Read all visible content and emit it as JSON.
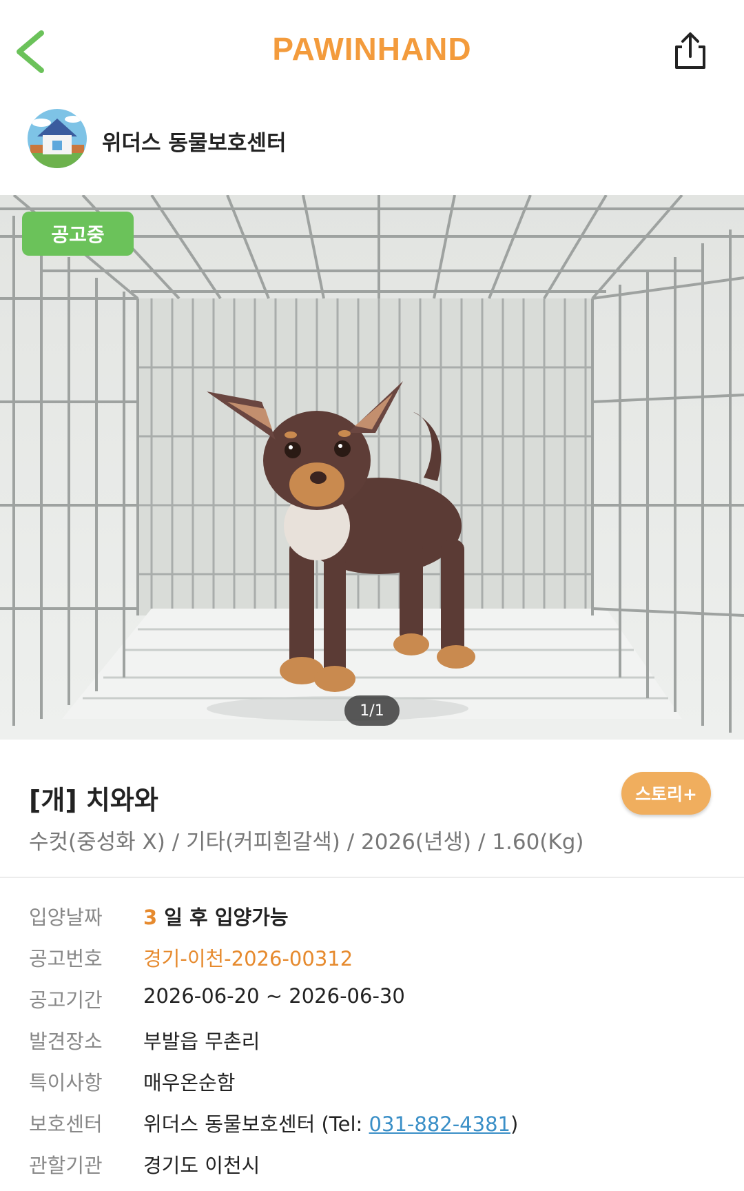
{
  "header": {
    "brand": "PAWINHAND"
  },
  "shelter": {
    "name": "위더스 동물보호센터"
  },
  "photo": {
    "status_badge": "공고중",
    "page_indicator": "1/1"
  },
  "animal": {
    "title": "[개] 치와와",
    "story_button": "스토리+",
    "subtitle": "수컷(중성화 X) / 기타(커피흰갈색) / 2026(년생) / 1.60(Kg)"
  },
  "info": {
    "adoption_date": {
      "label": "입양날짜",
      "days": "3",
      "text": " 일 후 입양가능"
    },
    "notice_no": {
      "label": "공고번호",
      "value": "경기-이천-2026-00312"
    },
    "notice_period": {
      "label": "공고기간",
      "value": "2026-06-20 ~ 2026-06-30"
    },
    "found_place": {
      "label": "발견장소",
      "value": "부발읍 무촌리"
    },
    "notes": {
      "label": "특이사항",
      "value": "매우온순함"
    },
    "shelter": {
      "label": "보호센터",
      "name": "위더스 동물보호센터 (Tel: ",
      "tel": "031-882-4381",
      "close": ")"
    },
    "authority": {
      "label": "관할기관",
      "value": "경기도 이천시"
    }
  },
  "colors": {
    "brand": "#F39B3C",
    "badge": "#6BC25A",
    "story": "#F0AE5E",
    "link": "#3A8FC7",
    "back": "#6BC25A"
  }
}
